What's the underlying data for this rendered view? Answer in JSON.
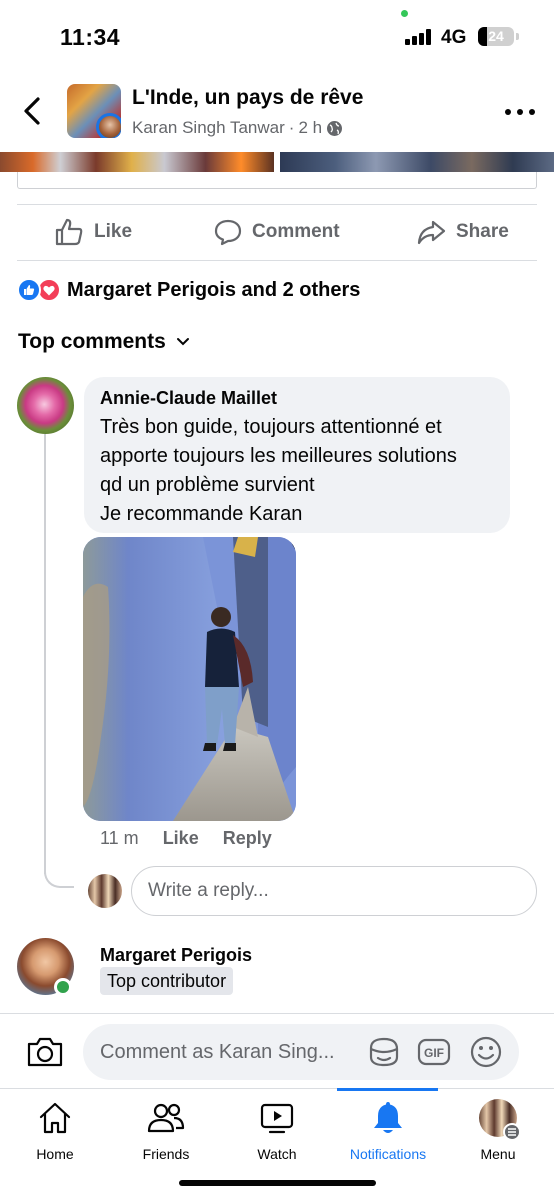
{
  "status_bar": {
    "time": "11:34",
    "network": "4G",
    "battery": "24",
    "battery_level": 0.24
  },
  "header": {
    "title": "L'Inde, un pays de rêve",
    "author": "Karan Singh Tanwar",
    "time": "2 h",
    "separator": "·",
    "audience_icon": "globe-icon"
  },
  "actions": {
    "like": "Like",
    "comment": "Comment",
    "share": "Share"
  },
  "reactions": {
    "summary": "Margaret Perigois and 2 others",
    "icons": [
      "like-reaction-icon",
      "love-reaction-icon"
    ]
  },
  "comments_header": {
    "label": "Top comments"
  },
  "comment1": {
    "author": "Annie-Claude Maillet",
    "lines": [
      "Très bon guide, toujours attentionné et",
      "apporte toujours les meilleures solutions",
      "qd un problème survient",
      "Je recommande Karan"
    ],
    "time": "11 m",
    "like": "Like",
    "reply": "Reply"
  },
  "reply_input": {
    "placeholder": "Write a reply..."
  },
  "comment2": {
    "author": "Margaret Perigois",
    "badge": "Top contributor"
  },
  "composer": {
    "placeholder": "Comment as Karan Sing..."
  },
  "tabbar": {
    "tabs": [
      {
        "label": "Home",
        "icon": "home-icon"
      },
      {
        "label": "Friends",
        "icon": "friends-icon"
      },
      {
        "label": "Watch",
        "icon": "watch-icon"
      },
      {
        "label": "Notifications",
        "icon": "bell-icon",
        "active": true
      },
      {
        "label": "Menu",
        "icon": "profile-avatar"
      }
    ]
  },
  "colors": {
    "accent": "#1877f2",
    "text": "#050505",
    "secondary": "#65676b",
    "bubble": "#f0f2f5",
    "love": "#f33e58",
    "online": "#31a24c"
  }
}
